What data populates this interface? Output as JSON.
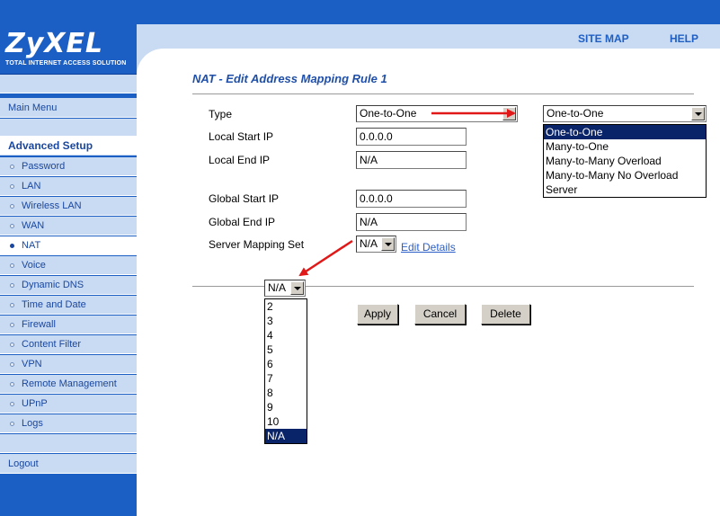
{
  "brand": {
    "name": "ZyXEL",
    "tagline": "TOTAL INTERNET ACCESS SOLUTION"
  },
  "toplinks": {
    "site_map": "SITE MAP",
    "help": "HELP"
  },
  "sidebar": {
    "main_menu": "Main Menu",
    "section": "Advanced Setup",
    "items": [
      {
        "label": "Password"
      },
      {
        "label": "LAN"
      },
      {
        "label": "Wireless LAN"
      },
      {
        "label": "WAN"
      },
      {
        "label": "NAT"
      },
      {
        "label": "Voice"
      },
      {
        "label": "Dynamic DNS"
      },
      {
        "label": "Time and Date"
      },
      {
        "label": "Firewall"
      },
      {
        "label": "Content Filter"
      },
      {
        "label": "VPN"
      },
      {
        "label": "Remote Management"
      },
      {
        "label": "UPnP"
      },
      {
        "label": "Logs"
      }
    ],
    "logout": "Logout"
  },
  "page": {
    "title": "NAT - Edit Address Mapping Rule 1"
  },
  "form": {
    "type_label": "Type",
    "type_value": "One-to-One",
    "local_start_label": "Local Start IP",
    "local_start_value": "0.0.0.0",
    "local_end_label": "Local End IP",
    "local_end_value": "N/A",
    "global_start_label": "Global Start IP",
    "global_start_value": "0.0.0.0",
    "global_end_label": "Global End IP",
    "global_end_value": "N/A",
    "server_set_label": "Server Mapping Set",
    "server_set_value": "N/A",
    "edit_details": "Edit Details"
  },
  "type_dropdown": {
    "selected": "One-to-One",
    "options": [
      "One-to-One",
      "Many-to-One",
      "Many-to-Many Overload",
      "Many-to-Many No Overload",
      "Server"
    ]
  },
  "set_dropdown": {
    "selected": "N/A",
    "options": [
      "2",
      "3",
      "4",
      "5",
      "6",
      "7",
      "8",
      "9",
      "10",
      "N/A"
    ]
  },
  "buttons": {
    "apply": "Apply",
    "cancel": "Cancel",
    "delete": "Delete"
  },
  "colors": {
    "header_blue": "#1b5fc4",
    "light_blue": "#c9dbf2",
    "title_blue": "#1f4fa8",
    "highlight": "#0a246a",
    "arrow_red": "#e01818"
  }
}
